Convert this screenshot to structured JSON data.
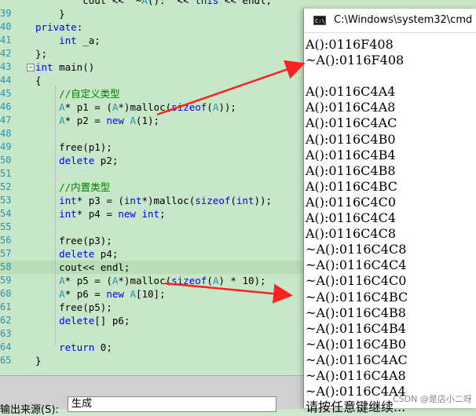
{
  "editor": {
    "lines": [
      {
        "n": "",
        "html": "    <span>cout << \"~A(): \" << </span><span class=\"kw\">this</span><span> << endl;</span>",
        "text": "        cout << \"~A():\" << this << endl;"
      },
      {
        "n": "39",
        "text": "    }"
      },
      {
        "n": "40",
        "text": "private:"
      },
      {
        "n": "41",
        "text": "    int _a;"
      },
      {
        "n": "42",
        "text": "};"
      },
      {
        "n": "43",
        "text": "int main()"
      },
      {
        "n": "44",
        "text": "{"
      },
      {
        "n": "45",
        "text": "    //自定义类型"
      },
      {
        "n": "46",
        "text": "    A* p1 = (A*)malloc(sizeof(A));"
      },
      {
        "n": "47",
        "text": "    A* p2 = new A(1);"
      },
      {
        "n": "48",
        "text": ""
      },
      {
        "n": "49",
        "text": "    free(p1);"
      },
      {
        "n": "50",
        "text": "    delete p2;"
      },
      {
        "n": "51",
        "text": ""
      },
      {
        "n": "52",
        "text": "    //内置类型"
      },
      {
        "n": "53",
        "text": "    int* p3 = (int*)malloc(sizeof(int));"
      },
      {
        "n": "54",
        "text": "    int* p4 = new int;"
      },
      {
        "n": "55",
        "text": ""
      },
      {
        "n": "56",
        "text": "    free(p3);"
      },
      {
        "n": "57",
        "text": "    delete p4;"
      },
      {
        "n": "58",
        "text": "    cout<< endl;"
      },
      {
        "n": "59",
        "text": "    A* p5 = (A*)malloc(sizeof(A) * 10);"
      },
      {
        "n": "60",
        "text": "    A* p6 = new A[10];"
      },
      {
        "n": "61",
        "text": "    free(p5);"
      },
      {
        "n": "62",
        "text": "    delete[] p6;"
      },
      {
        "n": "63",
        "text": ""
      },
      {
        "n": "64",
        "text": "    return 0;"
      },
      {
        "n": "65",
        "text": "}"
      }
    ]
  },
  "status": {
    "output_label": "输出来源(S):",
    "output_source": "生成"
  },
  "console": {
    "title": "C:\\Windows\\system32\\cmd",
    "lines": [
      "A():0116F408",
      "~A():0116F408",
      "",
      "A():0116C4A4",
      "A():0116C4A8",
      "A():0116C4AC",
      "A():0116C4B0",
      "A():0116C4B4",
      "A():0116C4B8",
      "A():0116C4BC",
      "A():0116C4C0",
      "A():0116C4C4",
      "A():0116C4C8",
      "~A():0116C4C8",
      "~A():0116C4C4",
      "~A():0116C4C0",
      "~A():0116C4BC",
      "~A():0116C4B8",
      "~A():0116C4B4",
      "~A():0116C4B0",
      "~A():0116C4AC",
      "~A():0116C4A8",
      "~A():0116C4A4",
      "请按任意键继续..."
    ]
  },
  "watermark": "CSDN @是店小二呀",
  "colors": {
    "editor_bg": "#c8e6c8",
    "keyword": "#0000ff",
    "type": "#2b91af",
    "comment": "#008000",
    "line_number": "#2b91af",
    "arrow": "#ff2020"
  }
}
